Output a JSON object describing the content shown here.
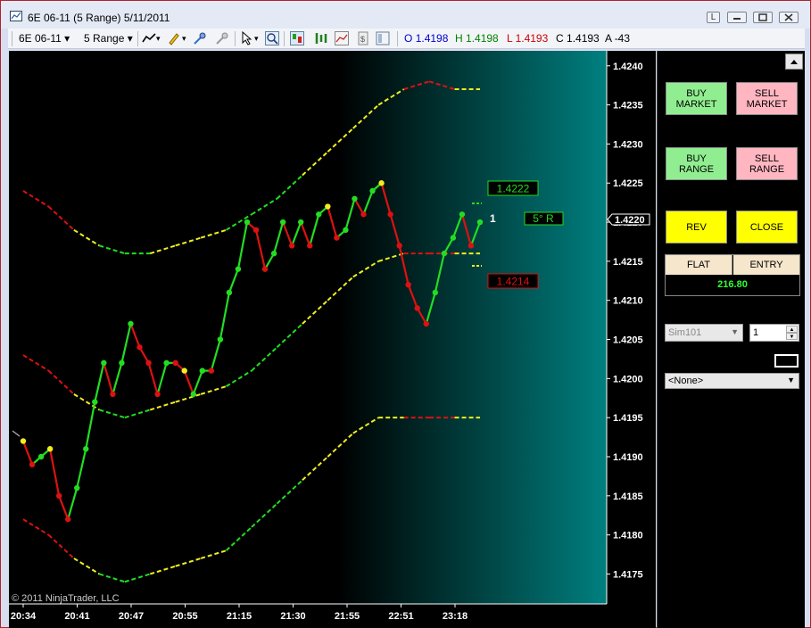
{
  "window": {
    "title": "6E 06-11 (5 Range)  5/11/2011",
    "controls": {
      "restore": "L"
    }
  },
  "toolbar": {
    "instrument": "6E 06-11",
    "period": "5 Range",
    "ohlc": {
      "open_label": "O",
      "open": "1.4198",
      "high_label": "H",
      "high": "1.4198",
      "low_label": "L",
      "low": "1.4193",
      "close_label": "C",
      "close": "1.4193",
      "ask_label": "A",
      "ask": "-43"
    }
  },
  "chart": {
    "copyright": "© 2011 NinjaTrader, LLC",
    "price_labels": [
      "1.4240",
      "1.4235",
      "1.4230",
      "1.4225",
      "1.4220",
      "1.4215",
      "1.4210",
      "1.4205",
      "1.4200",
      "1.4195",
      "1.4190",
      "1.4185",
      "1.4180",
      "1.4175"
    ],
    "current_price": "1.4220",
    "time_labels": [
      "20:34",
      "20:41",
      "20:47",
      "20:55",
      "21:15",
      "21:30",
      "21:55",
      "22:51",
      "23:18"
    ],
    "annotations": {
      "upper_target": "1.4222",
      "lower_target": "1.4214",
      "bar_counter": "1",
      "timer": "5°  R"
    },
    "colors": {
      "up": "#22dd22",
      "down": "#dd1111",
      "neutral": "#eeee22",
      "bg_fade": "#008080"
    }
  },
  "chart_data": {
    "type": "line",
    "yaxis": [
      1.4173,
      1.4241
    ],
    "price": [
      {
        "v": 1.4192,
        "c": "y"
      },
      {
        "v": 1.4189,
        "c": "r"
      },
      {
        "v": 1.419,
        "c": "g"
      },
      {
        "v": 1.4191,
        "c": "y"
      },
      {
        "v": 1.4185,
        "c": "r"
      },
      {
        "v": 1.4182,
        "c": "r"
      },
      {
        "v": 1.4186,
        "c": "g"
      },
      {
        "v": 1.4191,
        "c": "g"
      },
      {
        "v": 1.4197,
        "c": "g"
      },
      {
        "v": 1.4202,
        "c": "g"
      },
      {
        "v": 1.4198,
        "c": "r"
      },
      {
        "v": 1.4202,
        "c": "g"
      },
      {
        "v": 1.4207,
        "c": "g"
      },
      {
        "v": 1.4204,
        "c": "r"
      },
      {
        "v": 1.4202,
        "c": "r"
      },
      {
        "v": 1.4198,
        "c": "r"
      },
      {
        "v": 1.4202,
        "c": "g"
      },
      {
        "v": 1.4202,
        "c": "r"
      },
      {
        "v": 1.4201,
        "c": "y"
      },
      {
        "v": 1.4198,
        "c": "g"
      },
      {
        "v": 1.4201,
        "c": "g"
      },
      {
        "v": 1.4201,
        "c": "r"
      },
      {
        "v": 1.4205,
        "c": "g"
      },
      {
        "v": 1.4211,
        "c": "g"
      },
      {
        "v": 1.4214,
        "c": "g"
      },
      {
        "v": 1.422,
        "c": "g"
      },
      {
        "v": 1.4219,
        "c": "r"
      },
      {
        "v": 1.4214,
        "c": "r"
      },
      {
        "v": 1.4216,
        "c": "g"
      },
      {
        "v": 1.422,
        "c": "g"
      },
      {
        "v": 1.4217,
        "c": "r"
      },
      {
        "v": 1.422,
        "c": "g"
      },
      {
        "v": 1.4217,
        "c": "r"
      },
      {
        "v": 1.4221,
        "c": "g"
      },
      {
        "v": 1.4222,
        "c": "y"
      },
      {
        "v": 1.4218,
        "c": "r"
      },
      {
        "v": 1.4219,
        "c": "g"
      },
      {
        "v": 1.4223,
        "c": "g"
      },
      {
        "v": 1.4221,
        "c": "r"
      },
      {
        "v": 1.4224,
        "c": "g"
      },
      {
        "v": 1.4225,
        "c": "y"
      },
      {
        "v": 1.4221,
        "c": "r"
      },
      {
        "v": 1.4217,
        "c": "r"
      },
      {
        "v": 1.4212,
        "c": "r"
      },
      {
        "v": 1.4209,
        "c": "r"
      },
      {
        "v": 1.4207,
        "c": "r"
      },
      {
        "v": 1.4211,
        "c": "g"
      },
      {
        "v": 1.4216,
        "c": "g"
      },
      {
        "v": 1.4218,
        "c": "g"
      },
      {
        "v": 1.4221,
        "c": "g"
      },
      {
        "v": 1.4217,
        "c": "r"
      },
      {
        "v": 1.422,
        "c": "g"
      }
    ],
    "bands": {
      "upper": [
        1.4224,
        1.4222,
        1.4219,
        1.4217,
        1.4216,
        1.4216,
        1.4217,
        1.4218,
        1.4219,
        1.4221,
        1.4223,
        1.4226,
        1.4229,
        1.4232,
        1.4235,
        1.4237,
        1.4238,
        1.4237,
        1.4237
      ],
      "middle": [
        1.4203,
        1.4201,
        1.4198,
        1.4196,
        1.4195,
        1.4196,
        1.4197,
        1.4198,
        1.4199,
        1.4201,
        1.4204,
        1.4207,
        1.421,
        1.4213,
        1.4215,
        1.4216,
        1.4216,
        1.4216,
        1.4216
      ],
      "lower": [
        1.4182,
        1.418,
        1.4177,
        1.4175,
        1.4174,
        1.4175,
        1.4176,
        1.4177,
        1.4178,
        1.4181,
        1.4184,
        1.4187,
        1.419,
        1.4193,
        1.4195,
        1.4195,
        1.4195,
        1.4195,
        1.4195
      ],
      "colors": [
        "r",
        "r",
        "y",
        "g",
        "g",
        "y",
        "y",
        "y",
        "g",
        "g",
        "g",
        "y",
        "y",
        "y",
        "y",
        "r",
        "r",
        "y",
        "y"
      ]
    }
  },
  "panel": {
    "buy_market": "BUY\nMARKET",
    "sell_market": "SELL\nMARKET",
    "buy_range": "BUY\nRANGE",
    "sell_range": "SELL\nRANGE",
    "rev": "REV",
    "close": "CLOSE",
    "position_label": "FLAT",
    "entry_label": "ENTRY",
    "pnl": "216.80",
    "account": "Sim101",
    "quantity": "1",
    "strategy": "<None>"
  }
}
